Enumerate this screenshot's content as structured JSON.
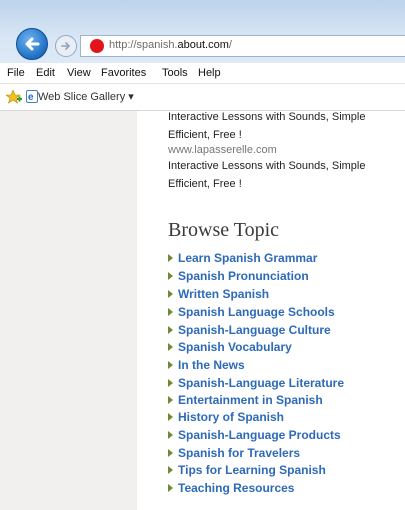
{
  "browser": {
    "url_prefix": "http://spanish.",
    "url_domain": "about.com",
    "url_suffix": "/",
    "menu": [
      "File",
      "Edit",
      "View",
      "Favorites",
      "Tools",
      "Help"
    ],
    "web_slice_label": "Web Slice Gallery ▾",
    "accent_color": "#1d6fc4"
  },
  "page": {
    "ads": [
      "Interactive Lessons with Sounds, Simple",
      "Efficient, Free !",
      "www.lapasserelle.com",
      "Interactive Lessons with Sounds, Simple",
      "Efficient, Free !"
    ],
    "browse_title": "Browse Topic",
    "topics": [
      "Learn Spanish Grammar",
      "Spanish Pronunciation",
      "Written Spanish",
      "Spanish Language Schools",
      "Spanish-Language Culture",
      "Spanish Vocabulary",
      "In the News",
      "Spanish-Language Literature",
      "Entertainment in Spanish",
      "History of Spanish",
      "Spanish-Language Products",
      "Spanish for Travelers",
      "Tips for Learning Spanish",
      "Teaching Resources"
    ],
    "link_color": "#2d6ab8"
  }
}
